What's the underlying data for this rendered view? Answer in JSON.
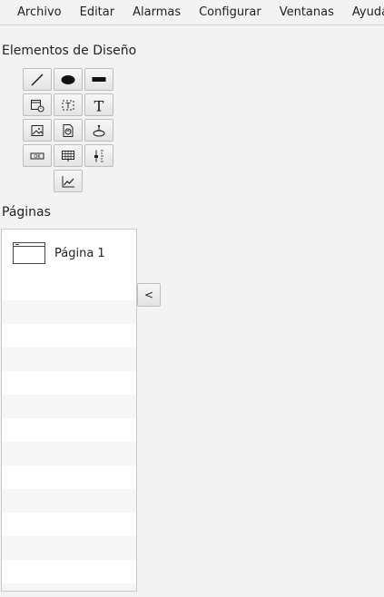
{
  "menubar": {
    "items": [
      "Archivo",
      "Editar",
      "Alarmas",
      "Configurar",
      "Ventanas",
      "Ayuda"
    ]
  },
  "design_elements": {
    "title": "Elementos de Diseño",
    "tools": [
      {
        "icon": "line-icon"
      },
      {
        "icon": "ellipse-icon"
      },
      {
        "icon": "rectangle-icon"
      },
      {
        "icon": "calendar-clock-icon"
      },
      {
        "icon": "text-field-icon"
      },
      {
        "icon": "text-icon"
      },
      {
        "icon": "image-icon"
      },
      {
        "icon": "document-image-icon"
      },
      {
        "icon": "tank-icon"
      },
      {
        "icon": "button-icon"
      },
      {
        "icon": "table-icon"
      },
      {
        "icon": "slider-icon"
      },
      {
        "icon": "chart-icon"
      }
    ]
  },
  "pages": {
    "title": "Páginas",
    "items": [
      {
        "label": "Página 1",
        "icon": "page-thumbnail-icon"
      }
    ],
    "collapse_label": "<"
  }
}
